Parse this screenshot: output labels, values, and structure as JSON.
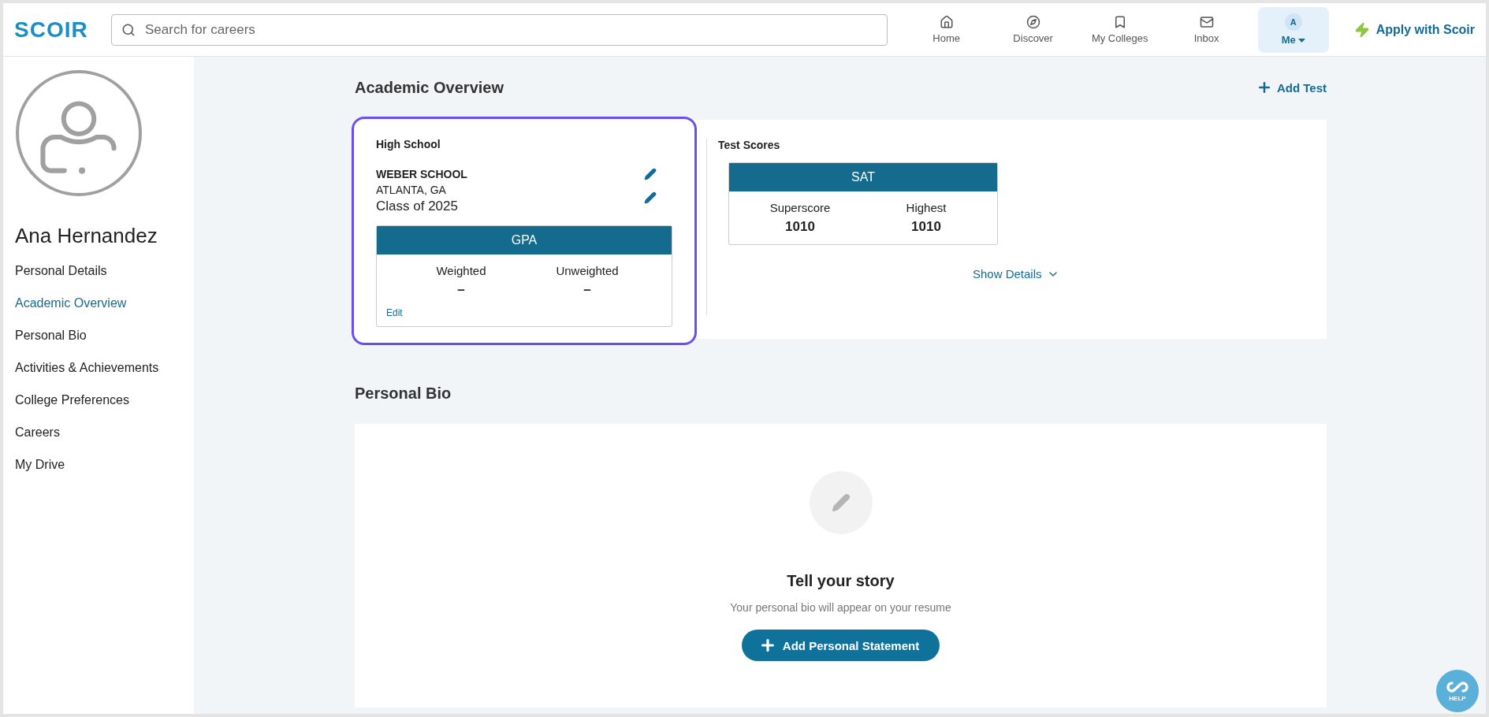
{
  "header": {
    "logo": "SCOIR",
    "search": {
      "placeholder": "Search for careers"
    },
    "nav": [
      {
        "label": "Home",
        "kind": "home",
        "selected": false
      },
      {
        "label": "Discover",
        "kind": "compass",
        "selected": false
      },
      {
        "label": "My Colleges",
        "kind": "bookmark",
        "selected": false
      },
      {
        "label": "Inbox",
        "kind": "mail",
        "selected": false
      },
      {
        "label": "Me",
        "kind": "avatar",
        "avatar": "A",
        "selected": true
      }
    ],
    "apply": "Apply with Scoir"
  },
  "sidebar": {
    "name": "Ana Hernandez",
    "items": [
      {
        "label": "Personal Details",
        "selected": false
      },
      {
        "label": "Academic Overview",
        "selected": true
      },
      {
        "label": "Personal Bio",
        "selected": false
      },
      {
        "label": "Activities & Achievements",
        "selected": false
      },
      {
        "label": "College Preferences",
        "selected": false
      },
      {
        "label": "Careers",
        "selected": false
      },
      {
        "label": "My Drive",
        "selected": false
      }
    ]
  },
  "academic": {
    "title": "Academic Overview",
    "add_test": "Add Test",
    "high_school": {
      "title": "High School",
      "highlighted": true,
      "school": "WEBER SCHOOL",
      "location": "ATLANTA, GA",
      "class": "Class of 2025",
      "gpa": {
        "title": "GPA",
        "columns": [
          {
            "label": "Weighted",
            "value": "–"
          },
          {
            "label": "Unweighted",
            "value": "–"
          }
        ],
        "edit": "Edit"
      }
    },
    "tests": {
      "title": "Test Scores",
      "sat": {
        "title": "SAT",
        "columns": [
          {
            "label": "Superscore",
            "value": "1010"
          },
          {
            "label": "Highest",
            "value": "1010"
          }
        ]
      },
      "show_details": "Show Details"
    }
  },
  "bio": {
    "title": "Personal Bio",
    "heading": "Tell your story",
    "text": "Your personal bio will appear on your resume",
    "button": "Add Personal Statement"
  },
  "help": "HELP"
}
